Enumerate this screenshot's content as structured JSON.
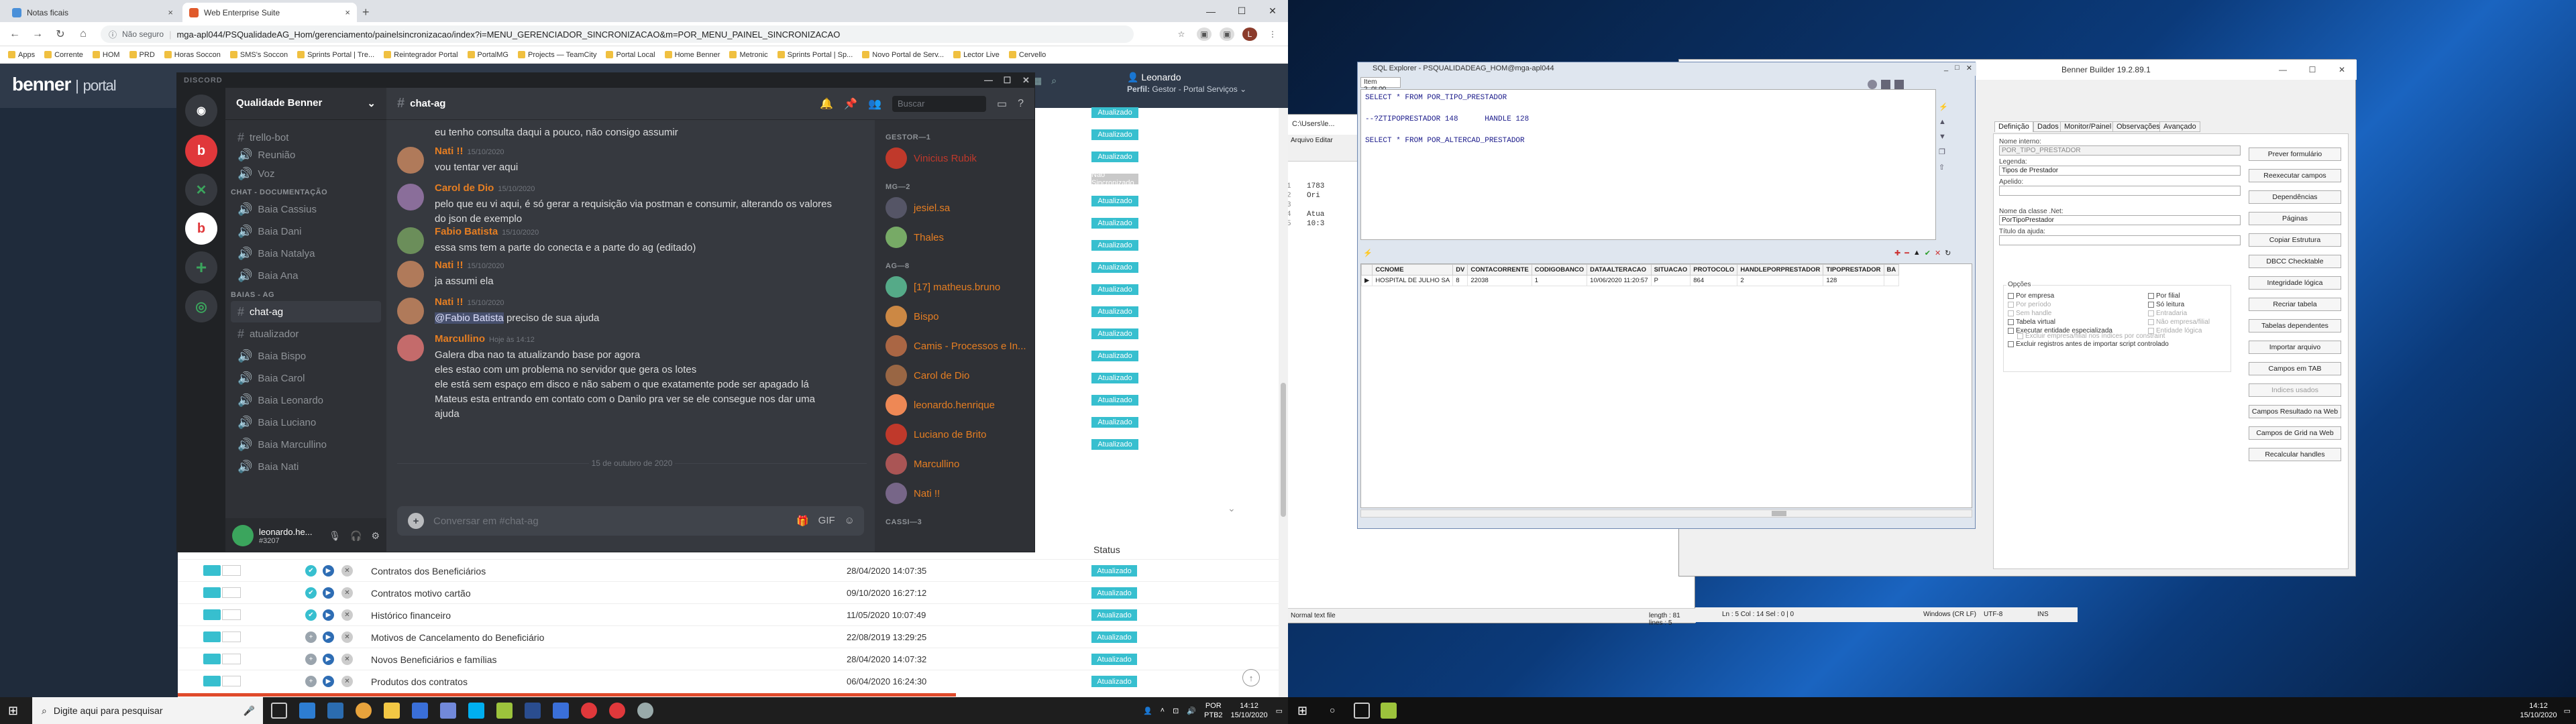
{
  "chrome": {
    "tabs": [
      {
        "title": "Notas ficais",
        "icon": "document-icon",
        "color": "#4a90d9"
      },
      {
        "title": "Web Enterprise Suite",
        "icon": "benner-icon",
        "color": "#e05a2b"
      }
    ],
    "security_label": "Não seguro",
    "url": "mga-apl044/PSQualidadeAG_Hom/gerenciamento/painelsincronizacao/index?i=MENU_GERENCIADOR_SINCRONIZACAO&m=POR_MENU_PAINEL_SINCRONIZACAO",
    "bookmarks": [
      "Apps",
      "Corrente",
      "HOM",
      "PRD",
      "Horas Soccon",
      "SMS's Soccon",
      "Sprints Portal | Tre...",
      "Reintegrador Portal",
      "PortalMG",
      "Projects — TeamCity",
      "Portal Local",
      "Home Benner",
      "Metronic",
      "Sprints Portal | Sp...",
      "Novo Portal de Serv...",
      "Lector Live",
      "Cervello"
    ]
  },
  "portal": {
    "logo_main": "benner",
    "logo_sub": "portal",
    "user_name": "Leonardo",
    "profile_label": "Perfil:",
    "profile_value": "Gestor - Portal Serviços",
    "status_header": "Status",
    "status_pills": [
      "Atualizado",
      "Atualizado",
      "Atualizado",
      "Não Sincronizado",
      "Atualizado",
      "Atualizado",
      "Atualizado",
      "Atualizado",
      "Atualizado",
      "Atualizado",
      "Atualizado",
      "Atualizado",
      "Atualizado",
      "Atualizado",
      "Atualizado",
      "Atualizado"
    ],
    "rows": [
      {
        "name": "Contratos dos Beneficiários",
        "date": "28/04/2020 14:07:35",
        "status": "Atualizado",
        "kind": "check"
      },
      {
        "name": "Contratos motivo cartão",
        "date": "09/10/2020 16:27:12",
        "status": "Atualizado",
        "kind": "check"
      },
      {
        "name": "Histórico financeiro",
        "date": "11/05/2020 10:07:49",
        "status": "Atualizado",
        "kind": "check"
      },
      {
        "name": "Motivos de Cancelamento do Beneficiário",
        "date": "22/08/2019 13:29:25",
        "status": "Atualizado",
        "kind": "plus"
      },
      {
        "name": "Novos Beneficiários e famílias",
        "date": "28/04/2020 14:07:32",
        "status": "Atualizado",
        "kind": "plus"
      },
      {
        "name": "Produtos dos contratos",
        "date": "06/04/2020 16:24:30",
        "status": "Atualizado",
        "kind": "plus"
      }
    ]
  },
  "discord": {
    "app_title": "DISCORD",
    "server_name": "Qualidade Benner",
    "categories": {
      "doc": "CHAT - DOCUMENTAÇÃO",
      "baias": "BAIAS - AG"
    },
    "channels_top": [
      "trello-bot",
      "Reunião",
      "Voz"
    ],
    "channels_doc": [
      "Baia Cassius",
      "Baia Dani",
      "Baia Natalya",
      "Baia Ana"
    ],
    "channels_ag": [
      "chat-ag",
      "atualizador",
      "Baia Bispo",
      "Baia Carol",
      "Baia Leonardo",
      "Baia Luciano",
      "Baia Marcullino",
      "Baia Nati"
    ],
    "active_channel": "chat-ag",
    "search_placeholder": "Buscar",
    "user": {
      "name": "leonardo.he...",
      "tag": "#3207"
    },
    "input_placeholder": "Conversar em #chat-ag",
    "date_divider": "15 de outubro de 2020",
    "messages": [
      {
        "author": "",
        "time": "",
        "color": "#dcddde",
        "lines": [
          "eu tenho consulta daqui a pouco, não consigo assumir"
        ]
      },
      {
        "author": "Nati !!",
        "time": "15/10/2020",
        "color": "#e67e22",
        "lines": [
          "vou tentar ver aqui"
        ]
      },
      {
        "author": "Carol de Dio",
        "time": "15/10/2020",
        "color": "#e67e22",
        "lines": [
          "pelo que eu vi aqui, é só gerar a requisição via postman e consumir, alterando os valores",
          "do json de exemplo"
        ]
      },
      {
        "author": "Fabio Batista",
        "time": "15/10/2020",
        "color": "#e67e22",
        "lines": [
          "essa sms tem a parte do conecta e a parte  do ag (editado)"
        ]
      },
      {
        "author": "Nati !!",
        "time": "15/10/2020",
        "color": "#e67e22",
        "lines": [
          "ja assumi ela"
        ]
      },
      {
        "author": "Nati !!",
        "time": "15/10/2020",
        "color": "#e67e22",
        "mention": "@Fabio Batista",
        "lines": [
          " preciso de sua ajuda"
        ]
      },
      {
        "author": "Marcullino",
        "time": "Hoje às 14:12",
        "color": "#e67e22",
        "lines": [
          "Galera dba nao ta atualizando base por agora",
          "eles estao com um problema no servidor que gera os lotes",
          "ele está sem espaço em disco e não sabem o que exatamente pode ser apagado lá",
          "Mateus esta entrando em contato com o Danilo pra ver se ele consegue nos dar uma",
          "ajuda"
        ]
      }
    ],
    "member_groups": [
      {
        "label": "GESTOR—1",
        "members": [
          {
            "name": "Vinicius Rubik",
            "color": "#c0392b"
          }
        ]
      },
      {
        "label": "MG—2",
        "members": [
          {
            "name": "jesiel.sa",
            "color": "#e67e22"
          },
          {
            "name": "Thales",
            "color": "#e67e22"
          }
        ]
      },
      {
        "label": "AG—8",
        "members": [
          {
            "name": "[17] matheus.bruno",
            "color": "#e67e22"
          },
          {
            "name": "Bispo",
            "color": "#e67e22"
          },
          {
            "name": "Camis - Processos e In...",
            "color": "#e67e22"
          },
          {
            "name": "Carol de Dio",
            "color": "#e67e22"
          },
          {
            "name": "leonardo.henrique",
            "color": "#e67e22"
          },
          {
            "name": "Luciano de Brito",
            "color": "#e67e22"
          },
          {
            "name": "Marcullino",
            "color": "#e67e22"
          },
          {
            "name": "Nati !!",
            "color": "#e67e22"
          }
        ]
      },
      {
        "label": "CASSI—3",
        "members": []
      }
    ]
  },
  "benner_builder": {
    "title": "Benner Builder 19.2.89.1",
    "tabs": [
      "Definição",
      "Dados",
      "Monitor/Painel",
      "Observações",
      "Avançado"
    ],
    "fields": {
      "nome_interno_label": "Nome interno:",
      "nome_interno": "POR_TIPO_PRESTADOR",
      "legenda_label": "Legenda:",
      "legenda": "Tipos de Prestador",
      "apelido_label": "Apelido:",
      "apelido": "",
      "classe_label": "Nome da classe .Net:",
      "classe": "PorTipoPrestador",
      "titulo_label": "Título da ajuda:",
      "titulo": ""
    },
    "options_label": "Opções",
    "options_left": [
      "Por empresa",
      "Por período",
      "Sem handle",
      "Tabela virtual",
      "Executar entidade especializada",
      "Excluir empresa/filial nos índices por constraint",
      "Excluir registros antes de importar script controlado"
    ],
    "options_right": [
      "Por filial",
      "Só leitura",
      "Entradaria",
      "Não empresa/filial",
      "Entidade lógica"
    ],
    "buttons": [
      "Prever formulário",
      "Reexecutar campos",
      "Dependências",
      "Páginas",
      "Copiar Estrutura",
      "DBCC Checktable",
      "Integridade lógica",
      "Recriar tabela",
      "Tabelas dependentes",
      "Importar arquivo",
      "Campos em TAB",
      "Indices usados",
      "Campos Resultado na Web",
      "Campos de Grid na Web",
      "Recalcular handles"
    ]
  },
  "notepad": {
    "path": "C:\\Users\\le...",
    "menu": "Arquivo  Editar",
    "lines": [
      "1783",
      "Ori",
      "",
      "Atua",
      "10:3"
    ],
    "status": {
      "type": "Normal text file",
      "length": "length : 81   lines : 5",
      "pos": "Ln : 5   Col : 14   Sel : 0 | 0",
      "eol": "Windows (CR LF)",
      "enc": "UTF-8",
      "ins": "INS"
    }
  },
  "sql_explorer": {
    "title": "SQL Explorer - PSQUALIDADEAG_HOM@mga-apl044",
    "tab": "Item 2_0L00",
    "query": "SELECT * FROM POR_TIPO_PRESTADOR\n\n--?ZTIPOPRESTADOR 148      HANDLE 128\n\nSELECT * FROM POR_ALTERCAD_PRESTADOR",
    "columns": [
      "CCNOME",
      "DV",
      "CONTACORRENTE",
      "CODIGOBANCO",
      "DATAALTERACAO",
      "SITUACAO",
      "PROTOCOLO",
      "HANDLEPORPRESTADOR",
      "TIPOPRESTADOR",
      "BA"
    ],
    "rows": [
      [
        "HOSPITAL DE JULHO SA",
        "8",
        "22038",
        "1",
        "10/06/2020 11:20:57",
        "P",
        "864",
        "2",
        "128",
        ""
      ]
    ]
  },
  "taskbar": {
    "search_placeholder": "Digite aqui para pesquisar",
    "lang": "POR",
    "lang2": "PTB2",
    "time": "14:12",
    "date": "15/10/2020"
  }
}
